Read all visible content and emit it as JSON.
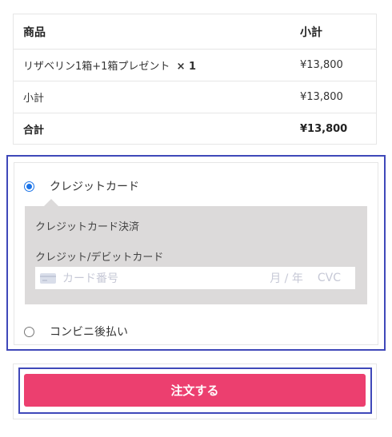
{
  "order": {
    "header": {
      "product": "商品",
      "subtotal": "小計"
    },
    "item": {
      "name": "リザベリン1箱+1箱プレゼント",
      "qty": "× 1",
      "price": "¥13,800"
    },
    "subtotal": {
      "label": "小計",
      "value": "¥13,800"
    },
    "total": {
      "label": "合計",
      "value": "¥13,800"
    }
  },
  "payment": {
    "methods": [
      {
        "label": "クレジットカード",
        "selected": true
      },
      {
        "label": "コンビニ後払い",
        "selected": false
      }
    ],
    "card_panel": {
      "title": "クレジットカード決済",
      "field_label": "クレジット/デビットカード",
      "number_placeholder": "カード番号",
      "expiry_placeholder": "月 / 年",
      "cvc_placeholder": "CVC"
    }
  },
  "actions": {
    "place_order": "注文する"
  },
  "colors": {
    "accent_button": "#ec3f6f",
    "highlight_border": "#3f48b9",
    "radio_selected": "#1a73e8",
    "card_panel_bg": "#dcdada"
  }
}
